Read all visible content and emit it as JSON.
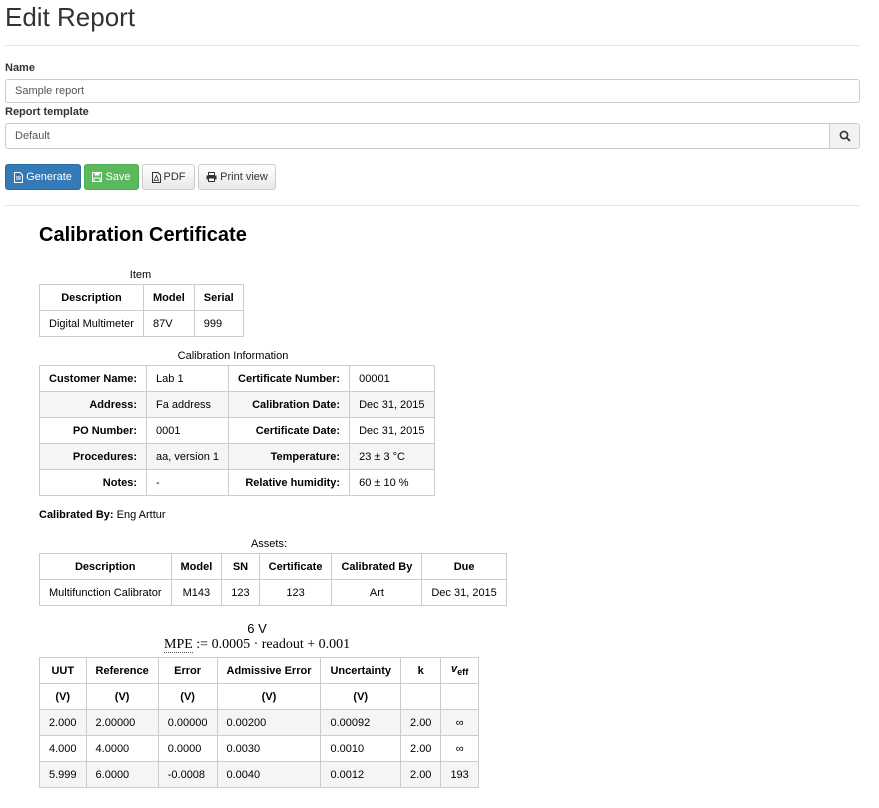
{
  "page": {
    "title": "Edit Report"
  },
  "form": {
    "name_label": "Name",
    "name_value": "Sample report",
    "template_label": "Report template",
    "template_value": "Default"
  },
  "toolbar": {
    "generate": "Generate",
    "save": "Save",
    "pdf": "PDF",
    "print": "Print view"
  },
  "colors": {
    "primary": "#337ab7",
    "success": "#5cb85c"
  },
  "report": {
    "title": "Calibration Certificate",
    "item": {
      "caption": "Item",
      "headers": [
        "Description",
        "Model",
        "Serial"
      ],
      "row": [
        "Digital Multimeter",
        "87V",
        "999"
      ]
    },
    "calinfo": {
      "caption": "Calibration Information",
      "rows": [
        [
          "Customer Name:",
          "Lab 1",
          "Certificate Number:",
          "00001"
        ],
        [
          "Address:",
          "Fa address",
          "Calibration Date:",
          "Dec 31, 2015"
        ],
        [
          "PO Number:",
          "0001",
          "Certificate Date:",
          "Dec 31, 2015"
        ],
        [
          "Procedures:",
          "aa, version 1",
          "Temperature:",
          "23 ± 3 °C"
        ],
        [
          "Notes:",
          "-",
          "Relative humidity:",
          "60 ± 10 %"
        ]
      ]
    },
    "calibrated_by_label": "Calibrated By:",
    "calibrated_by_value": "Eng Arttur",
    "assets": {
      "caption": "Assets:",
      "headers": [
        "Description",
        "Model",
        "SN",
        "Certificate",
        "Calibrated By",
        "Due"
      ],
      "row": [
        "Multifunction Calibrator",
        "M143",
        "123",
        "123",
        "Art",
        "Dec 31, 2015"
      ]
    },
    "measurement": {
      "range": "6 V",
      "mpe_var": "MPE",
      "mpe_rest": " := 0.0005 · readout + 0.001",
      "headers": [
        "UUT",
        "Reference",
        "Error",
        "Admissive Error",
        "Uncertainty",
        "k"
      ],
      "veff_label": "v",
      "veff_sub": "eff",
      "units": [
        "(V)",
        "(V)",
        "(V)",
        "(V)",
        "(V)",
        "",
        ""
      ],
      "rows": [
        [
          "2.000",
          "2.00000",
          "0.00000",
          "0.00200",
          "0.00092",
          "2.00",
          "∞"
        ],
        [
          "4.000",
          "4.0000",
          "0.0000",
          "0.0030",
          "0.0010",
          "2.00",
          "∞"
        ],
        [
          "5.999",
          "6.0000",
          "-0.0008",
          "0.0040",
          "0.0012",
          "2.00",
          "193"
        ]
      ]
    }
  }
}
